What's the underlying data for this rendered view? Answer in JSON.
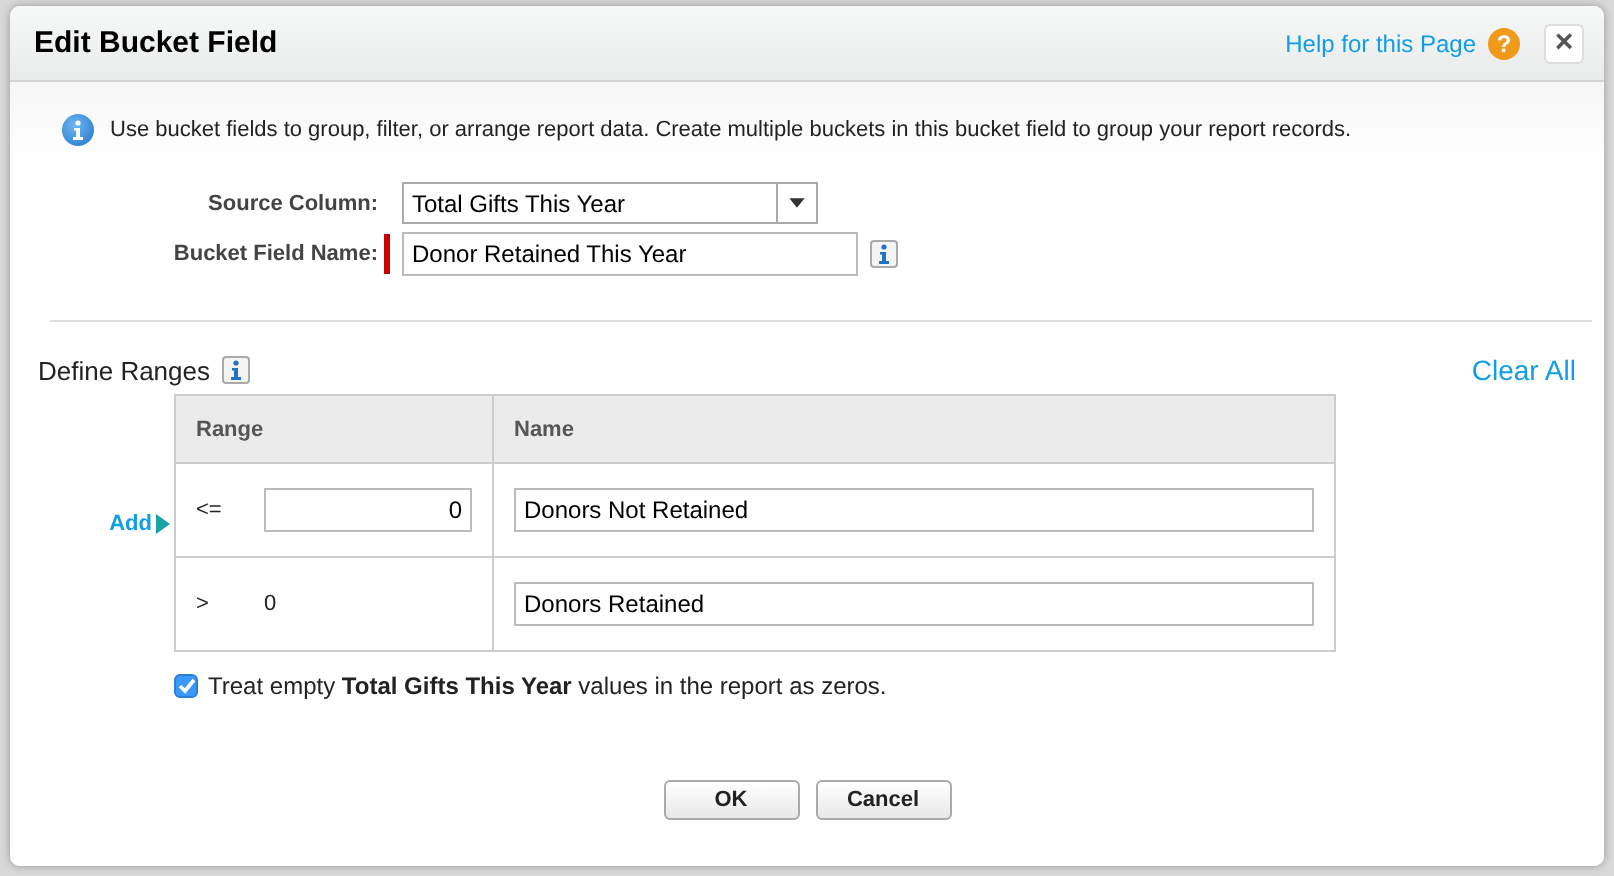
{
  "dialog": {
    "title": "Edit Bucket Field",
    "help_link": "Help for this Page",
    "help_icon": "?",
    "close": "×"
  },
  "info": "Use bucket fields to group, filter, or arrange report data. Create multiple buckets in this bucket field to group your report records.",
  "form": {
    "source_label": "Source Column:",
    "source_value": "Total Gifts This Year",
    "name_label": "Bucket Field Name:",
    "name_value": "Donor Retained This Year",
    "name_required": true
  },
  "ranges": {
    "title": "Define Ranges",
    "clear_all": "Clear All",
    "add": "Add",
    "columns": [
      "Range",
      "Name"
    ],
    "rows": [
      {
        "kind": "input",
        "operator": "<=",
        "value": "0",
        "name": "Donors Not Retained"
      },
      {
        "kind": "static",
        "operator": ">",
        "value": "0",
        "name": "Donors Retained"
      }
    ]
  },
  "treat_empty": {
    "checked": true,
    "text": "Treat empty **Total Gifts This Year** values in the report as zeros."
  },
  "buttons": [
    "OK",
    "Cancel"
  ]
}
